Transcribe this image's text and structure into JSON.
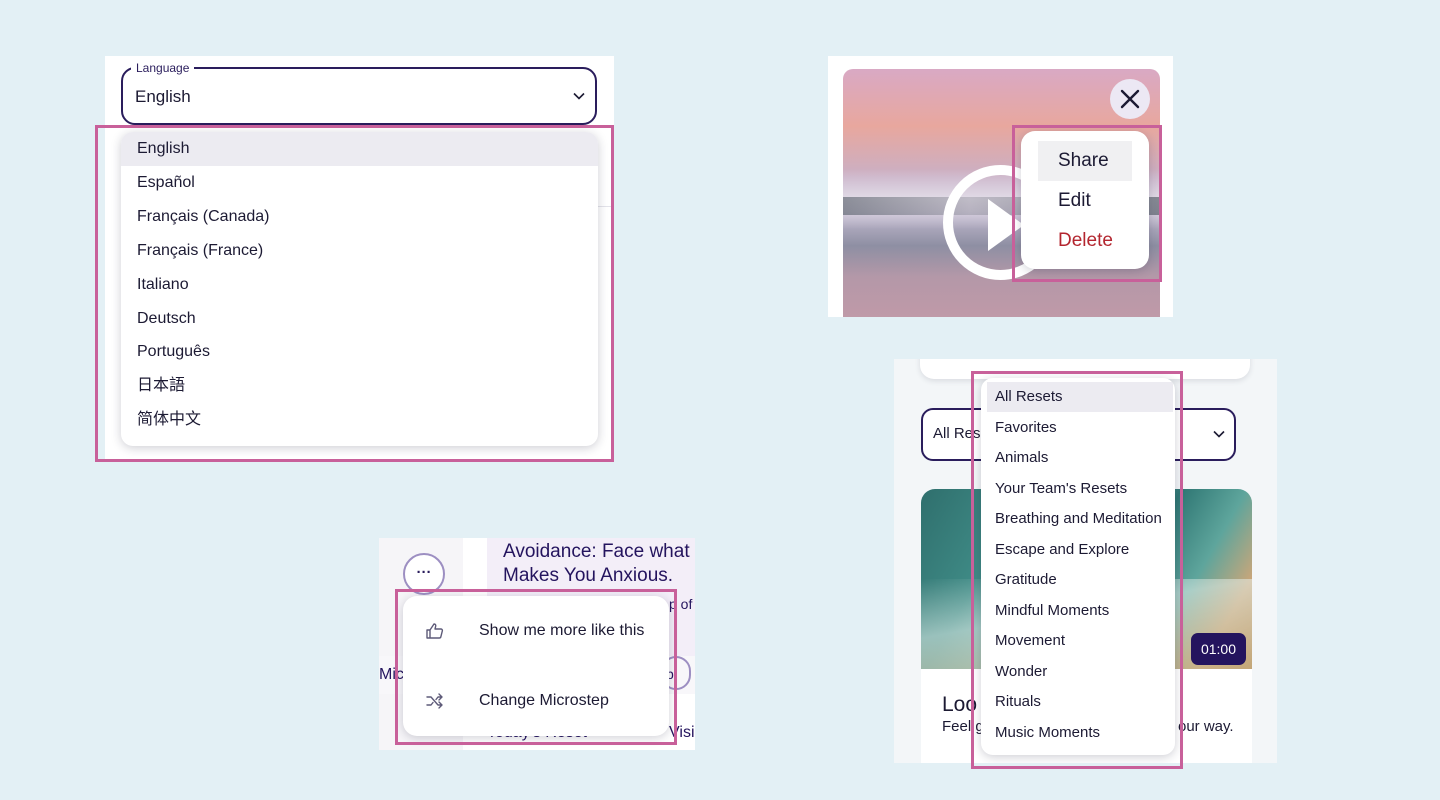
{
  "language_panel": {
    "legend": "Language",
    "value": "English",
    "options": [
      "English",
      "Español",
      "Français (Canada)",
      "Français (France)",
      "Italiano",
      "Deutsch",
      "Português",
      "日本語",
      "简体中文"
    ],
    "selected": "English"
  },
  "video_panel": {
    "menu": [
      "Share",
      "Edit",
      "Delete"
    ],
    "selected": "Share",
    "danger_color": "#b3262f",
    "icons": {
      "close": "close-icon",
      "play": "play-icon"
    }
  },
  "microstep_panel": {
    "title": "Avoidance: Face what Makes You Anxious.",
    "subtitle_fragment": "p of",
    "left_fragment": "Micr",
    "pill_fragment": "p",
    "today_fragment": "Today's Reset",
    "visit_fragment": "Visi",
    "more_button": "···",
    "menu": [
      {
        "label": "Show me more like this",
        "icon": "thumbs-up-icon"
      },
      {
        "label": "Change Microstep",
        "icon": "shuffle-icon"
      }
    ]
  },
  "resets_panel": {
    "filter_value": "All Rese",
    "options": [
      "All Resets",
      "Favorites",
      "Animals",
      "Your Team's Resets",
      "Breathing and Meditation",
      "Escape and Explore",
      "Gratitude",
      "Mindful Moments",
      "Movement",
      "Wonder",
      "Rituals",
      "Music Moments"
    ],
    "selected": "All Resets",
    "card": {
      "duration": "01:00",
      "title": "Loo",
      "subtitle_start": "Feel g",
      "subtitle_end": "our way."
    }
  },
  "colors": {
    "highlight": "#c8609a",
    "brand_navy": "#24145e",
    "background": "#e3f0f5"
  }
}
